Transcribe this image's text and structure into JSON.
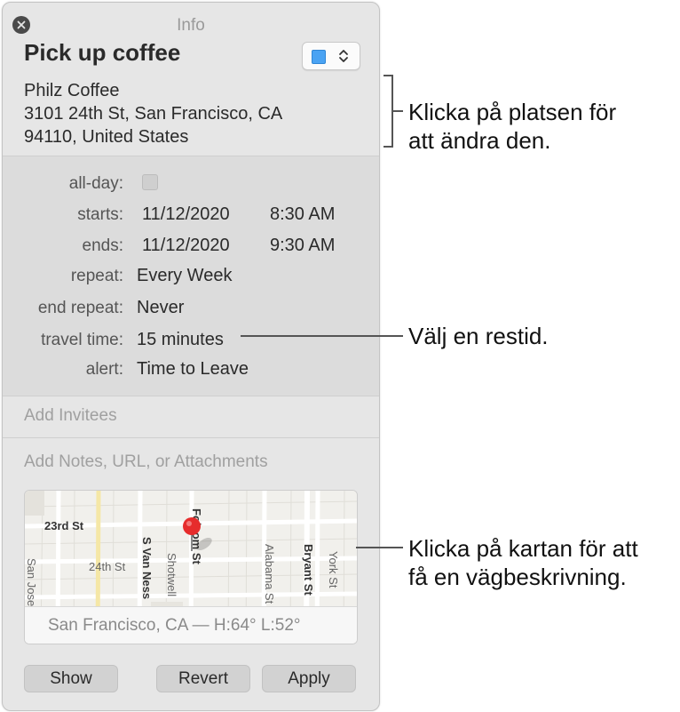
{
  "window": {
    "title": "Info"
  },
  "event": {
    "title": "Pick up coffee",
    "location_lines": [
      "Philz Coffee",
      "3101 24th St, San Francisco, CA",
      "94110, United States"
    ],
    "calendar_color": "#4aa3f3"
  },
  "details": {
    "allday_label": "all-day:",
    "starts_label": "starts:",
    "starts_date": "11/12/2020",
    "starts_time": "8:30 AM",
    "ends_label": "ends:",
    "ends_date": "11/12/2020",
    "ends_time": "9:30 AM",
    "repeat_label": "repeat:",
    "repeat_value": "Every Week",
    "end_repeat_label": "end repeat:",
    "end_repeat_value": "Never",
    "travel_label": "travel time:",
    "travel_value": "15 minutes",
    "alert_label": "alert:",
    "alert_value": "Time to Leave"
  },
  "invitees_placeholder": "Add Invitees",
  "notes_placeholder": "Add Notes, URL, or Attachments",
  "map": {
    "streets": [
      "23rd St",
      "24th St",
      "S Van Ness",
      "Shotwell",
      "Folsom St",
      "Alabama St",
      "Bryant St",
      "York St",
      "San Jose"
    ],
    "caption": "San Francisco, CA — H:64° L:52°"
  },
  "buttons": {
    "show": "Show",
    "revert": "Revert",
    "apply": "Apply"
  },
  "callouts": {
    "location": [
      "Klicka på platsen för",
      "att ändra den."
    ],
    "travel": "Välj en restid.",
    "map": [
      "Klicka på kartan för att",
      "få en vägbeskrivning."
    ]
  }
}
